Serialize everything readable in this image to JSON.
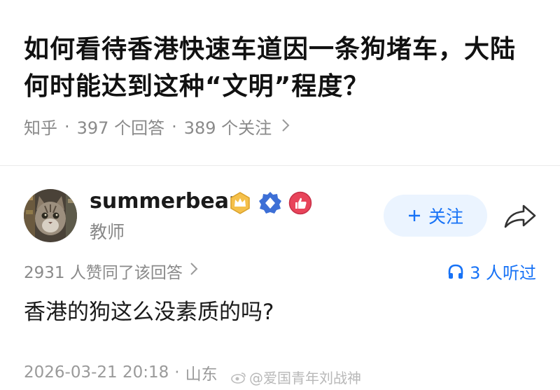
{
  "question": {
    "title": "如何看待香港快速车道因一条狗堵车，大陆何时能达到这种“文明”程度？",
    "source": "知乎",
    "answer_count": "397 个回答",
    "follower_count": "389 个关注"
  },
  "author": {
    "name": "summerbear",
    "role": "教师",
    "avatar": "cat-avatar",
    "badges": [
      "crown-badge-icon",
      "diamond-badge-icon",
      "thumb-badge-icon"
    ]
  },
  "actions": {
    "follow_label": "关注",
    "share_icon": "share-arrow-icon"
  },
  "answer": {
    "likes": "2931 人赞同了该回答",
    "listeners": "3 人听过",
    "text": "香港的狗这么没素质的吗?",
    "datetime": "2026-03-21 20:18",
    "location": "山东"
  },
  "watermark": "@爱国青年刘战神",
  "colors": {
    "accent": "#1772f6",
    "follow_bg": "#ebf4ff",
    "meta_gray": "#8a8a8a"
  }
}
